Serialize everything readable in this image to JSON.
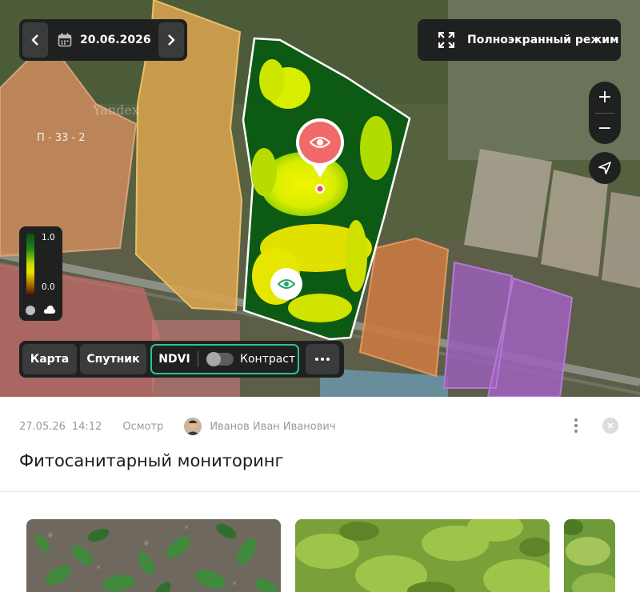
{
  "map": {
    "field_label": "П - 33 - 2",
    "watermark": "Yandex",
    "date": "20.06.2026",
    "fullscreen_label": "Полноэкранный режим",
    "legend": {
      "max": "1.0",
      "min": "0.0"
    },
    "toolbar": {
      "map_label": "Карта",
      "satellite_label": "Спутник",
      "ndvi_label": "NDVI",
      "contrast_label": "Контраст",
      "contrast_enabled": false
    },
    "zoom_in": "+",
    "zoom_out": "−",
    "icons": [
      "chevron-left-icon",
      "calendar-icon",
      "chevron-right-icon",
      "fullscreen-icon",
      "navigation-arrow-icon",
      "eye-icon",
      "cloud-icon",
      "more-icon"
    ],
    "colors": {
      "accent": "#2fc386",
      "panel": "#1f2121",
      "pin": "#f06a6a"
    }
  },
  "record": {
    "date": "27.05.26",
    "time": "14:12",
    "type": "Осмотр",
    "author": "Иванов Иван Иванович",
    "title": "Фитосанитарный мониторинг",
    "photo_count_visible": 3
  }
}
